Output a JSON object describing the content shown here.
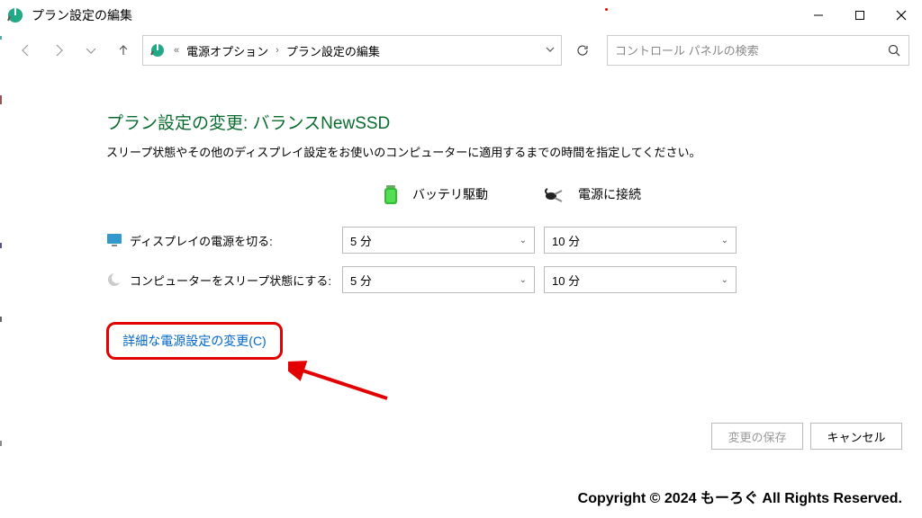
{
  "window": {
    "title": "プラン設定の編集"
  },
  "breadcrumb": {
    "parent": "電源オプション",
    "current": "プラン設定の編集"
  },
  "search": {
    "placeholder": "コントロール パネルの検索"
  },
  "main": {
    "heading": "プラン設定の変更: バランスNewSSD",
    "description": "スリープ状態やその他のディスプレイ設定をお使いのコンピューターに適用するまでの時間を指定してください。",
    "columns": {
      "battery": "バッテリ駆動",
      "plugged": "電源に接続"
    },
    "rows": [
      {
        "label": "ディスプレイの電源を切る:",
        "battery_value": "5 分",
        "plugged_value": "10 分"
      },
      {
        "label": "コンピューターをスリープ状態にする:",
        "battery_value": "5 分",
        "plugged_value": "10 分"
      }
    ],
    "advanced_link": "詳細な電源設定の変更(C)"
  },
  "buttons": {
    "save": "変更の保存",
    "cancel": "キャンセル"
  },
  "footer": {
    "copyright": "Copyright © 2024 もーろぐ All Rights Reserved."
  }
}
